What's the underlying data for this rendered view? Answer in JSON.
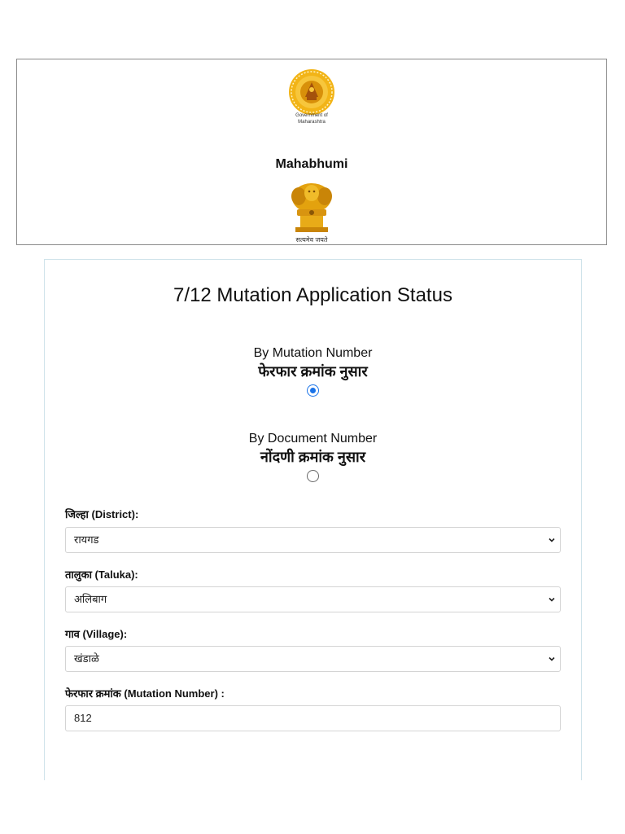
{
  "header": {
    "emblem_caption_line1": "Government of",
    "emblem_caption_line2": "Maharashtra",
    "site_name": "Mahabhumi",
    "motto": "सत्यमेव जयते"
  },
  "form": {
    "title": "7/12 Mutation Application Status",
    "options": [
      {
        "label_en": "By Mutation Number",
        "label_mr": "फेरफार क्रमांक नुसार",
        "checked": true
      },
      {
        "label_en": "By Document Number",
        "label_mr": "नोंदणी क्रमांक नुसार",
        "checked": false
      }
    ],
    "district": {
      "label": "जिल्हा (District):",
      "value": "रायगड"
    },
    "taluka": {
      "label": "तालुका (Taluka):",
      "value": "अलिबाग"
    },
    "village": {
      "label": "गाव (Village):",
      "value": "खंडाळे"
    },
    "mutation_number": {
      "label": "फेरफार क्रमांक (Mutation Number) :",
      "value": "812"
    }
  },
  "colors": {
    "accent": "#1a73e8",
    "emblem_gold": "#e8a80c",
    "card_border": "#cfe3ea"
  }
}
